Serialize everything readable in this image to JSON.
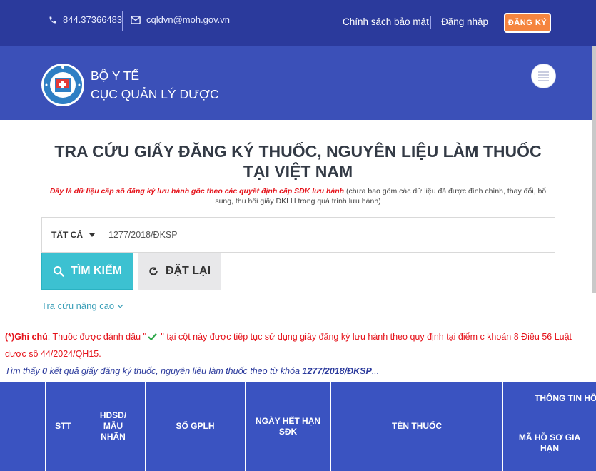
{
  "topbar": {
    "phone": "844.37366483",
    "email": "cqldvn@moh.gov.vn",
    "privacy_link": "Chính sách bảo mật",
    "login_link": "Đăng nhập",
    "register_button": "ĐĂNG KÝ"
  },
  "header": {
    "line1": "BỘ Y TẾ",
    "line2": "CỤC QUẢN LÝ DƯỢC"
  },
  "main": {
    "title_line1": "TRA CỨU GIẤY ĐĂNG KÝ THUỐC, NGUYÊN LIỆU LÀM THUỐC",
    "title_line2": "TẠI VIỆT NAM",
    "subnote_red": "Đây là dữ liệu cấp số đăng ký lưu hành gốc theo các quyết định cấp SĐK lưu hành",
    "subnote_rest": " (chưa bao gồm các dữ liệu đã được đính chính, thay đổi, bổ sung, thu hồi giấy ĐKLH trong quá trình lưu hành)"
  },
  "search": {
    "filter_label": "TẤT CẢ",
    "query": "1277/2018/ĐKSP",
    "search_button": "TÌM KIẾM",
    "reset_button": "ĐẶT LẠI",
    "advanced_link": "Tra cứu nâng cao"
  },
  "note": {
    "prefix": "(*)Ghi chú",
    "part1": ": Thuốc được đánh dấu \"",
    "part2": " \" tại cột này được tiếp tục sử dụng giấy đăng ký lưu hành theo quy định tại điểm c khoản 8 Điều 56 Luật dược số 44/2024/QH15."
  },
  "result": {
    "part1": "Tìm thấy ",
    "count": "0",
    "part2": " kết quả giấy đăng ký thuốc, nguyên liệu làm thuốc theo từ khóa ",
    "keyword": "1277/2018/ĐKSP",
    "part3": "..."
  },
  "table": {
    "headers": [
      "STT",
      "HDSD/ MẪU NHÃN",
      "SỐ GPLH",
      "NGÀY HẾT HẠN SĐK",
      "TÊN THUỐC"
    ],
    "group_header": "THÔNG TIN HỒ",
    "sub_header": "MÃ HỒ SƠ GIA HẠN"
  },
  "colors": {
    "topbar": "#2b3a9c",
    "header": "#3b50b8",
    "accent_orange": "#f5853f",
    "search_button": "#3cc1d1",
    "table_header": "#3a53c1",
    "note_red": "#e5121a"
  }
}
